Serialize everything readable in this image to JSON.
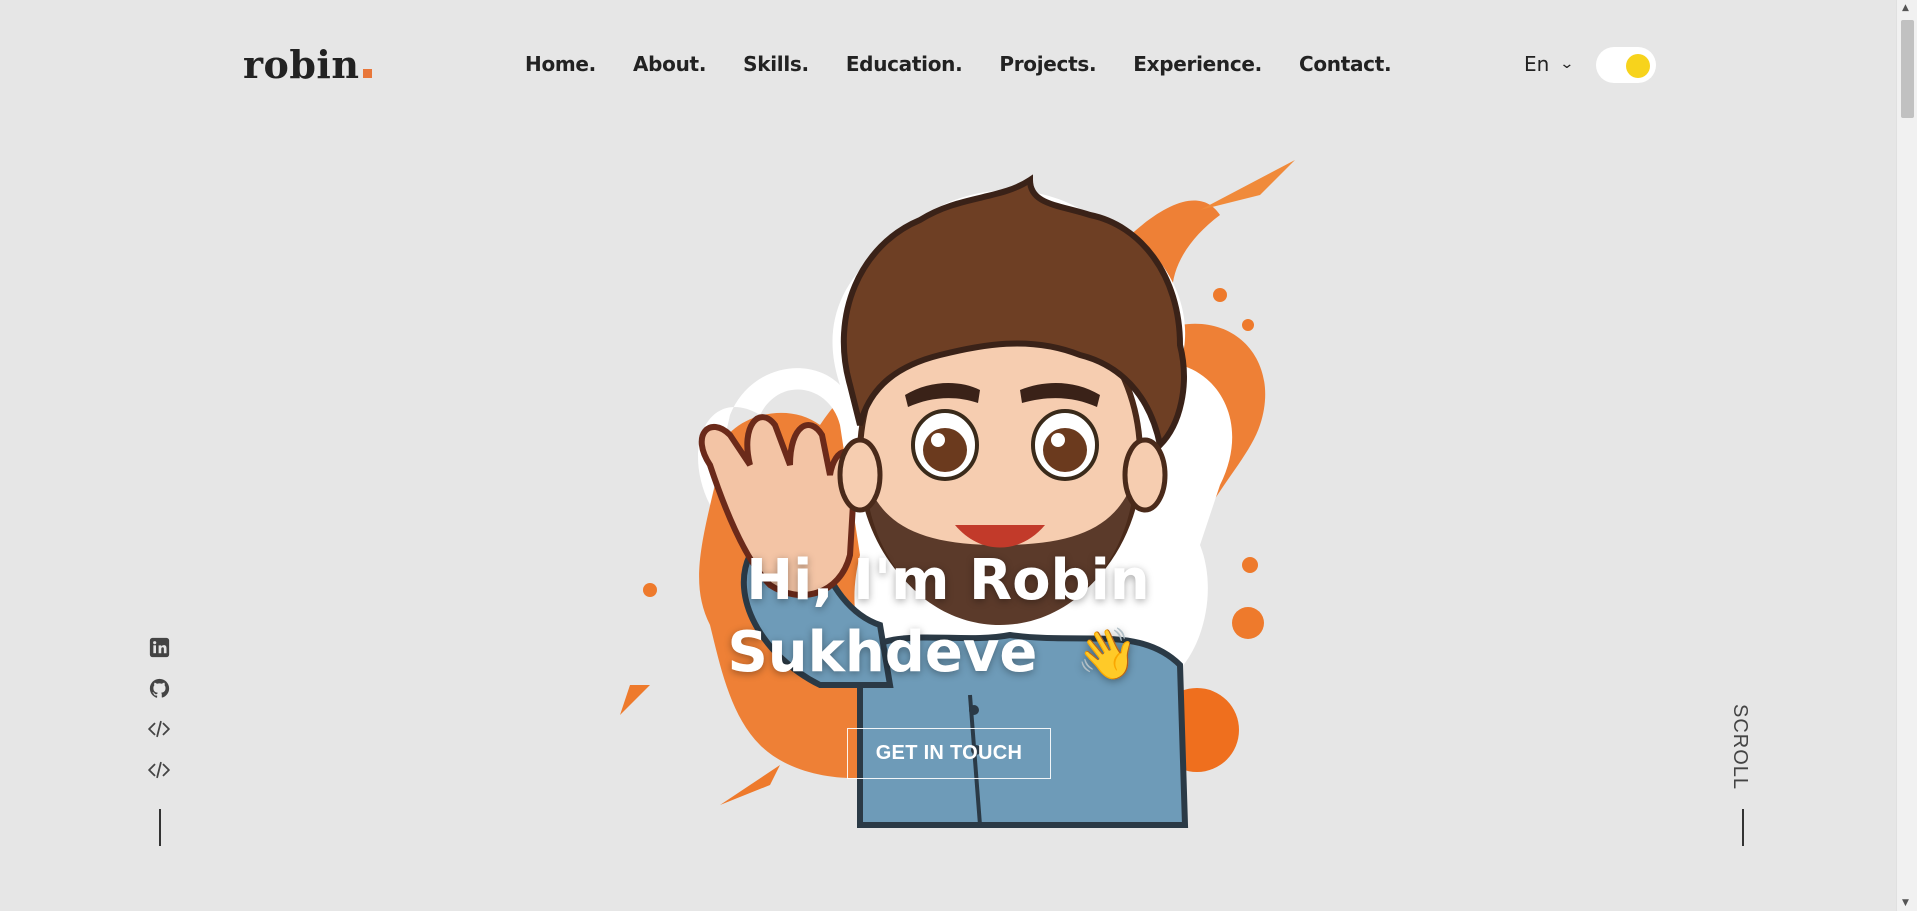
{
  "header": {
    "logo_text": "robin",
    "nav": [
      "Home.",
      "About.",
      "Skills.",
      "Education.",
      "Projects.",
      "Experience.",
      "Contact."
    ],
    "language": "En",
    "theme_toggle": "light"
  },
  "hero": {
    "greeting_line1": "Hi, I'm Robin",
    "greeting_line2": "Sukhdeve",
    "wave_emoji": "👋",
    "cta_label": "GET IN TOUCH"
  },
  "social": {
    "icons": [
      "linkedin-icon",
      "github-icon",
      "code-icon",
      "code-icon"
    ]
  },
  "scroll_label": "SCROLL",
  "colors": {
    "background": "#e6e6e6",
    "accent": "#e8773a",
    "toggle_knob": "#f7d31c",
    "text": "#222222"
  }
}
